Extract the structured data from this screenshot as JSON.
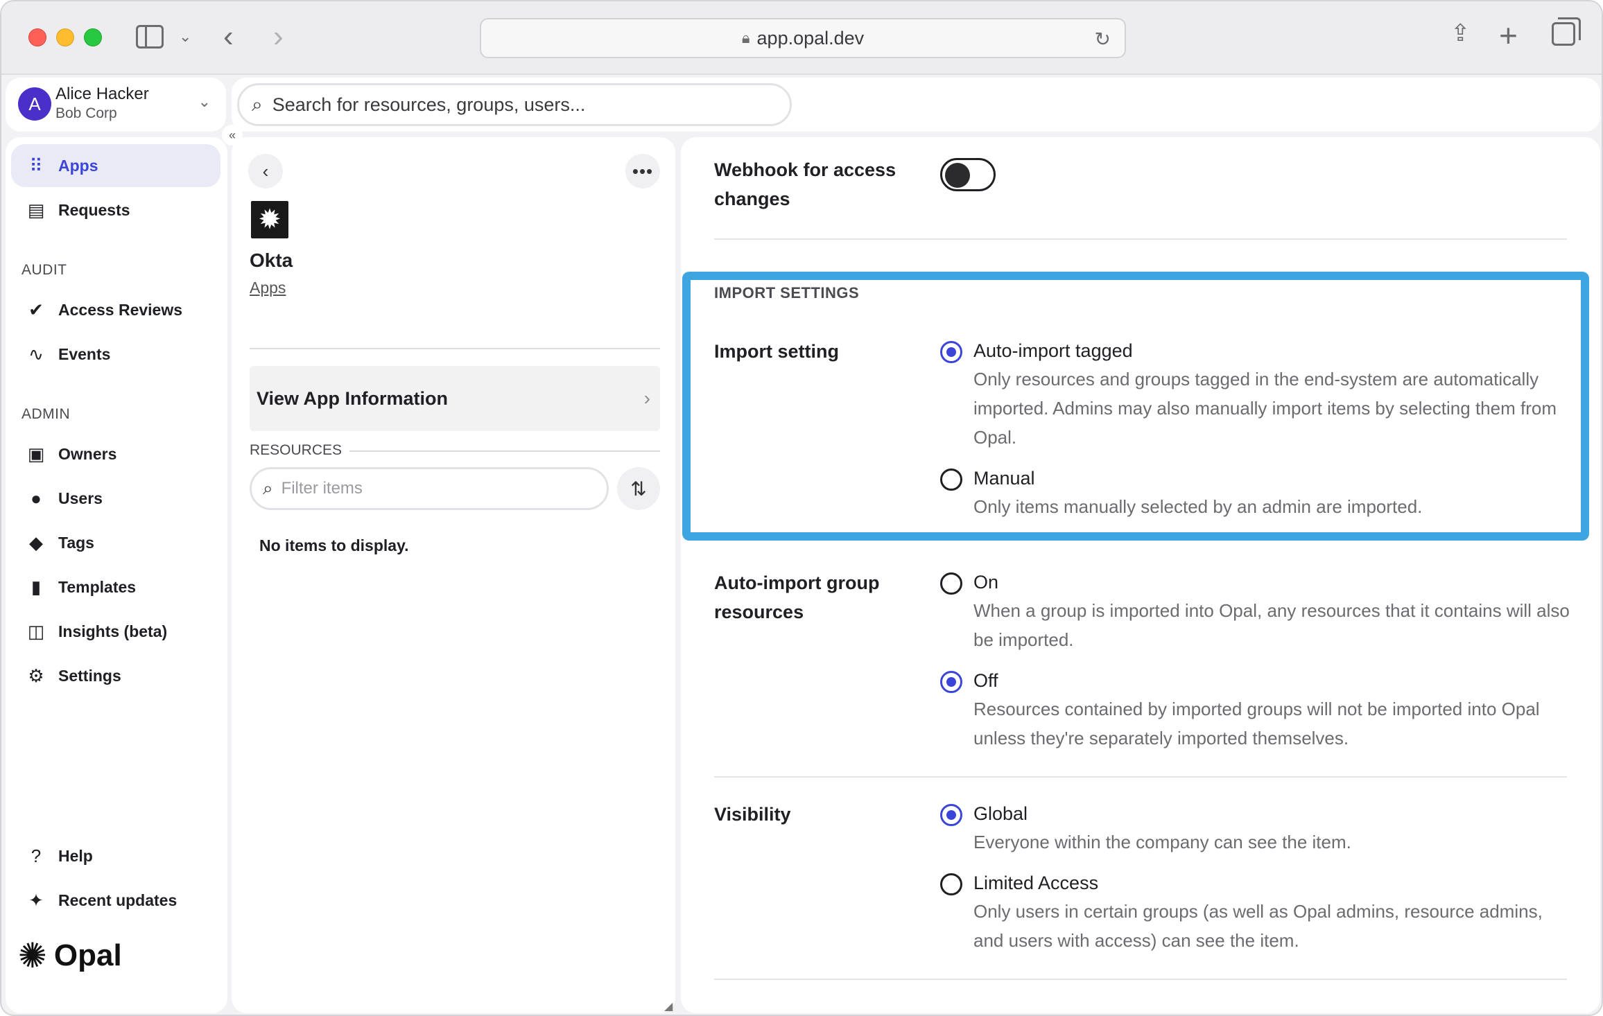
{
  "browser": {
    "url": "app.opal.dev"
  },
  "user": {
    "initial": "A",
    "name": "Alice Hacker",
    "org": "Bob Corp"
  },
  "search": {
    "placeholder": "Search for resources, groups, users..."
  },
  "sidebar": {
    "items": [
      {
        "label": "Apps",
        "icon": "grid-icon"
      },
      {
        "label": "Requests",
        "icon": "inbox-icon"
      },
      {
        "label": "Access Reviews",
        "icon": "check-circle-icon"
      },
      {
        "label": "Events",
        "icon": "activity-icon"
      },
      {
        "label": "Owners",
        "icon": "owner-icon"
      },
      {
        "label": "Users",
        "icon": "user-icon"
      },
      {
        "label": "Tags",
        "icon": "tag-icon"
      },
      {
        "label": "Templates",
        "icon": "clipboard-icon"
      },
      {
        "label": "Insights (beta)",
        "icon": "insights-icon"
      },
      {
        "label": "Settings",
        "icon": "gear-icon"
      },
      {
        "label": "Help",
        "icon": "help-icon"
      },
      {
        "label": "Recent updates",
        "icon": "sparkle-icon"
      }
    ],
    "sections": {
      "audit": "AUDIT",
      "admin": "ADMIN"
    },
    "logo_text": "Opal"
  },
  "app_panel": {
    "title": "Okta",
    "breadcrumb": "Apps",
    "view_info_label": "View App Information",
    "resources_label": "RESOURCES",
    "filter_placeholder": "Filter items",
    "empty_text": "No items to display."
  },
  "settings": {
    "webhook_label": "Webhook for access changes",
    "webhook_enabled": false,
    "import_section": "IMPORT SETTINGS",
    "import_setting": {
      "label": "Import setting",
      "options": [
        {
          "label": "Auto-import tagged",
          "desc": "Only resources and groups tagged in the end-system are automatically imported. Admins may also manually import items by selecting them from Opal.",
          "checked": true
        },
        {
          "label": "Manual",
          "desc": "Only items manually selected by an admin are imported.",
          "checked": false
        }
      ]
    },
    "auto_import_group": {
      "label": "Auto-import group resources",
      "options": [
        {
          "label": "On",
          "desc": "When a group is imported into Opal, any resources that it contains will also be imported.",
          "checked": false
        },
        {
          "label": "Off",
          "desc": "Resources contained by imported groups will not be imported into Opal unless they're separately imported themselves.",
          "checked": true
        }
      ]
    },
    "visibility": {
      "label": "Visibility",
      "options": [
        {
          "label": "Global",
          "desc": "Everyone within the company can see the item.",
          "checked": true
        },
        {
          "label": "Limited Access",
          "desc": "Only users in certain groups (as well as Opal admins, resource admins, and users with access) can see the item.",
          "checked": false
        }
      ]
    }
  },
  "colors": {
    "accent": "#3b46d8",
    "highlight_border": "#3da5e0",
    "avatar": "#4b2fc9"
  }
}
